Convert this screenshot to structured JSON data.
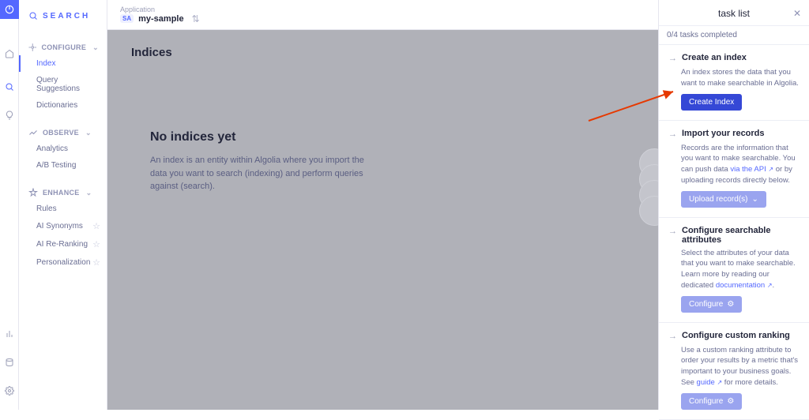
{
  "product": {
    "name": "SEARCH"
  },
  "header": {
    "app_label": "Application",
    "app_badge": "SA",
    "app_name": "my-sample"
  },
  "sidebar": {
    "sections": [
      {
        "title": "CONFIGURE",
        "items": [
          {
            "label": "Index",
            "active": true
          },
          {
            "label": "Query Suggestions"
          },
          {
            "label": "Dictionaries"
          }
        ]
      },
      {
        "title": "OBSERVE",
        "items": [
          {
            "label": "Analytics"
          },
          {
            "label": "A/B Testing"
          }
        ]
      },
      {
        "title": "ENHANCE",
        "items": [
          {
            "label": "Rules"
          },
          {
            "label": "AI Synonyms",
            "star": true
          },
          {
            "label": "AI Re-Ranking",
            "star": true
          },
          {
            "label": "Personalization",
            "star": true
          }
        ]
      }
    ]
  },
  "main": {
    "heading": "Indices",
    "empty_title": "No indices yet",
    "empty_desc": "An index is an entity within Algolia where you import the data you want to search (indexing) and perform queries against (search)."
  },
  "taskpanel": {
    "title": "task list",
    "progress": "0/4 tasks completed",
    "tasks": [
      {
        "title": "Create an index",
        "desc_pre": "An index stores the data that you want to make searchable in Algolia.",
        "button": "Create Index",
        "btn_variant": "primary"
      },
      {
        "title": "Import your records",
        "desc_pre": "Records are the information that you want to make searchable. You can push data ",
        "link_text": "via the API",
        "desc_post": " or by uploading records directly below.",
        "button": "Upload record(s)",
        "btn_variant": "muted",
        "chevron": true
      },
      {
        "title": "Configure searchable attributes",
        "desc_pre": "Select the attributes of your data that you want to make searchable. Learn more by reading our dedicated ",
        "link_text": "documentation",
        "desc_post": ".",
        "button": "Configure",
        "btn_variant": "muted",
        "gear": true
      },
      {
        "title": "Configure custom ranking",
        "desc_pre": "Use a custom ranking attribute to order your results by a metric that's important to your business goals. See ",
        "link_text": "guide",
        "desc_post": " for more details.",
        "button": "Configure",
        "btn_variant": "muted",
        "gear": true
      }
    ]
  }
}
